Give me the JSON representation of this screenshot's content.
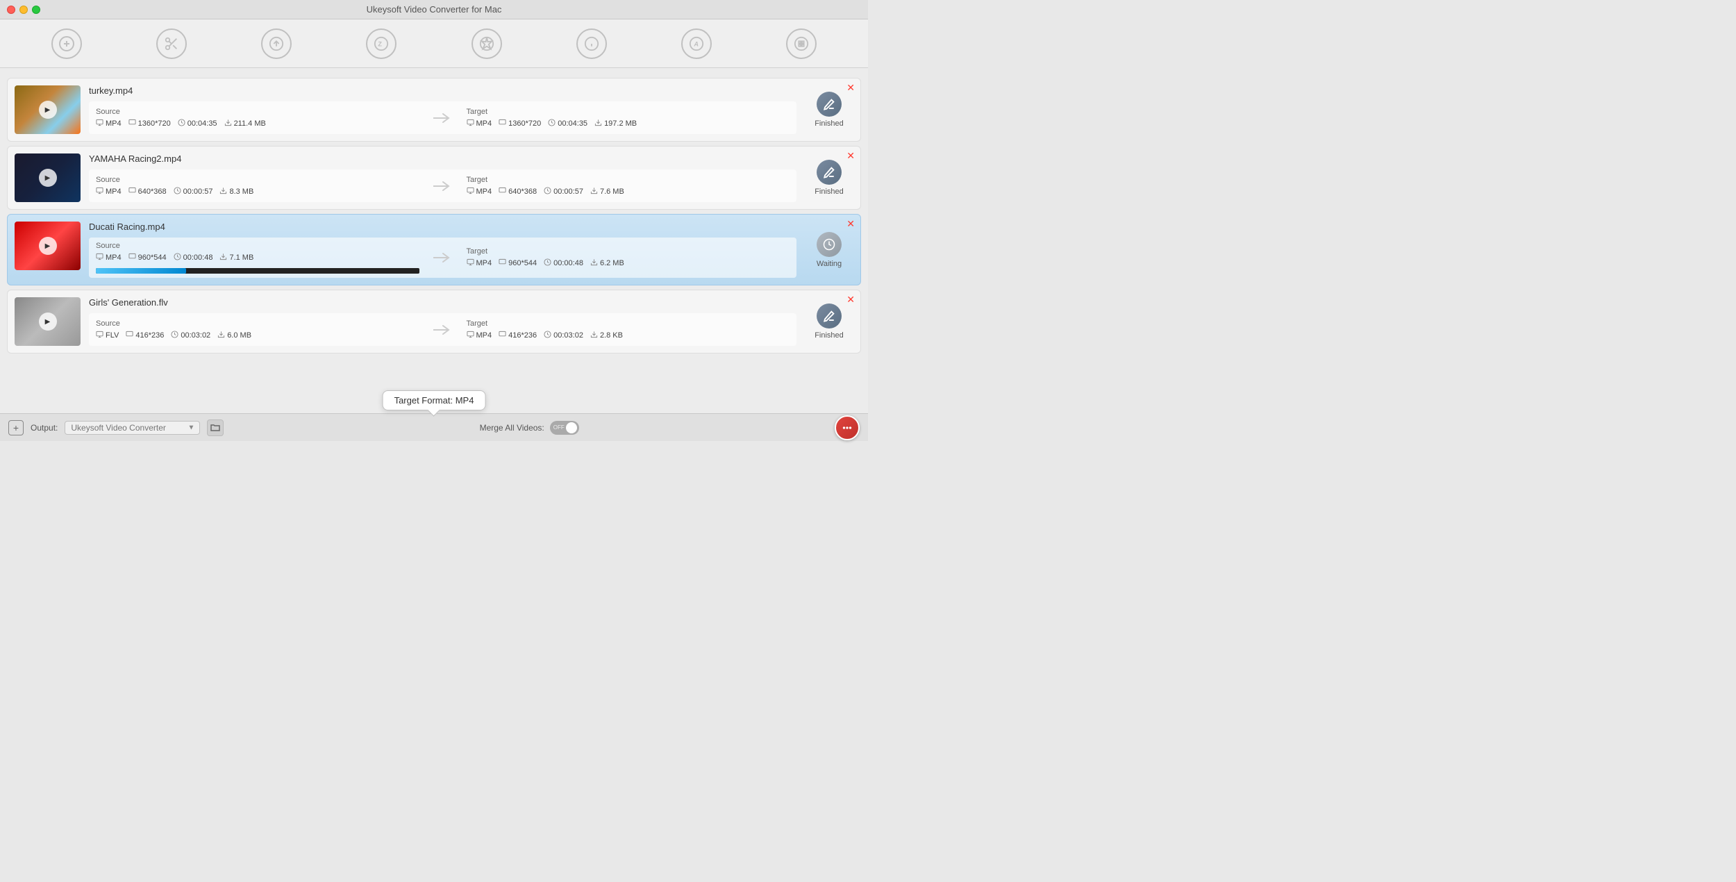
{
  "app": {
    "title": "Ukeysoft Video Converter for Mac"
  },
  "toolbar": {
    "items": [
      {
        "id": "add",
        "icon": "+",
        "label": "Add"
      },
      {
        "id": "trim",
        "icon": "✂",
        "label": "Trim"
      },
      {
        "id": "convert",
        "icon": "↻",
        "label": "Convert"
      },
      {
        "id": "compress",
        "icon": "Z",
        "label": "Compress"
      },
      {
        "id": "effects",
        "icon": "✦",
        "label": "Effects"
      },
      {
        "id": "info",
        "icon": "i",
        "label": "Info"
      },
      {
        "id": "watermark",
        "icon": "A",
        "label": "Watermark"
      },
      {
        "id": "history",
        "icon": "⧉",
        "label": "History"
      }
    ]
  },
  "videos": [
    {
      "id": "turkey",
      "filename": "turkey.mp4",
      "thumbnail_class": "thumb-turkey",
      "source": {
        "label": "Source",
        "format": "MP4",
        "resolution": "1360*720",
        "duration": "00:04:35",
        "size": "211.4 MB"
      },
      "target": {
        "label": "Target",
        "format": "MP4",
        "resolution": "1360*720",
        "duration": "00:04:35",
        "size": "197.2 MB"
      },
      "status": "Finished",
      "status_type": "finished",
      "active": false,
      "progress": null
    },
    {
      "id": "yamaha",
      "filename": "YAMAHA Racing2.mp4",
      "thumbnail_class": "thumb-yamaha",
      "source": {
        "label": "Source",
        "format": "MP4",
        "resolution": "640*368",
        "duration": "00:00:57",
        "size": "8.3 MB"
      },
      "target": {
        "label": "Target",
        "format": "MP4",
        "resolution": "640*368",
        "duration": "00:00:57",
        "size": "7.6 MB"
      },
      "status": "Finished",
      "status_type": "finished",
      "active": false,
      "progress": null
    },
    {
      "id": "ducati",
      "filename": "Ducati Racing.mp4",
      "thumbnail_class": "thumb-ducati",
      "source": {
        "label": "Source",
        "format": "MP4",
        "resolution": "960*544",
        "duration": "00:00:48",
        "size": "7.1 MB"
      },
      "target": {
        "label": "Target",
        "format": "MP4",
        "resolution": "960*544",
        "duration": "00:00:48",
        "size": "6.2 MB"
      },
      "status": "Waiting",
      "status_type": "waiting",
      "active": true,
      "progress": 28
    },
    {
      "id": "girls",
      "filename": "Girls' Generation.flv",
      "thumbnail_class": "thumb-girls",
      "source": {
        "label": "Source",
        "format": "FLV",
        "resolution": "416*236",
        "duration": "00:03:02",
        "size": "6.0 MB"
      },
      "target": {
        "label": "Target",
        "format": "MP4",
        "resolution": "416*236",
        "duration": "00:03:02",
        "size": "2.8 KB"
      },
      "status": "Finished",
      "status_type": "finished",
      "active": false,
      "progress": null
    }
  ],
  "bottom_bar": {
    "add_label": "+",
    "output_label": "Output:",
    "output_value": "Ukeysoft Video Converter",
    "output_placeholder": "Ukeysoft Video Converter",
    "merge_label": "Merge All Videos:",
    "toggle_state": "OFF"
  },
  "tooltip": {
    "text": "Target Format: MP4"
  }
}
